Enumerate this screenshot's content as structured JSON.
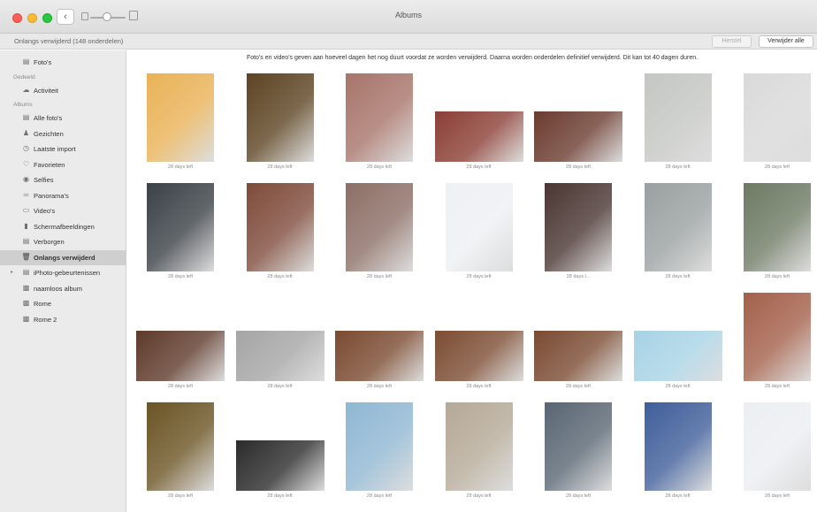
{
  "window": {
    "title": "Albums",
    "back_glyph": "‹"
  },
  "subbar": {
    "title": "Onlangs verwijderd (148 onderdelen)",
    "restore_label": "Herstel",
    "delete_all_label": "Verwijder alle"
  },
  "sidebar": {
    "top_items": [
      {
        "label": "Foto's",
        "icon": "photos-icon",
        "glyph": "▤"
      }
    ],
    "shared_header": "Gedeeld",
    "shared_items": [
      {
        "label": "Activiteit",
        "icon": "cloud-icon",
        "glyph": "☁"
      }
    ],
    "albums_header": "Albums",
    "album_items": [
      {
        "label": "Alle foto's",
        "icon": "all-photos-icon",
        "glyph": "▤"
      },
      {
        "label": "Gezichten",
        "icon": "person-icon",
        "glyph": "♟"
      },
      {
        "label": "Laatste import",
        "icon": "clock-icon",
        "glyph": "◷"
      },
      {
        "label": "Favorieten",
        "icon": "heart-icon",
        "glyph": "♡"
      },
      {
        "label": "Selfies",
        "icon": "selfie-icon",
        "glyph": "◉"
      },
      {
        "label": "Panorama's",
        "icon": "panorama-icon",
        "glyph": "═"
      },
      {
        "label": "Video's",
        "icon": "video-icon",
        "glyph": "▭"
      },
      {
        "label": "Schermafbeeldingen",
        "icon": "phone-icon",
        "glyph": "▮"
      },
      {
        "label": "Verborgen",
        "icon": "hidden-icon",
        "glyph": "▤"
      },
      {
        "label": "Onlangs verwijderd",
        "icon": "trash-icon",
        "glyph": "🗑",
        "selected": true
      },
      {
        "label": "iPhoto-gebeurtenissen",
        "icon": "folder-icon",
        "glyph": "▤",
        "disclosure": "▸"
      },
      {
        "label": "naamloos album",
        "icon": "album-thumbnail-icon",
        "glyph": "▩"
      },
      {
        "label": "Rome",
        "icon": "album-thumbnail-icon",
        "glyph": "▩"
      },
      {
        "label": "Rome 2",
        "icon": "album-thumbnail-icon",
        "glyph": "▩"
      }
    ]
  },
  "main": {
    "info_text": "Foto's en video's geven aan hoeveel dagen het nog duurt voordat ze worden verwijderd. Daarna worden onderdelen definitief verwijderd. Dit kan tot 40 dagen duren.",
    "rows": [
      {
        "items": [
          {
            "caption": "28 days left",
            "color": "#e9b257",
            "orientation": "portrait"
          },
          {
            "caption": "28 days left",
            "color": "#5c4322",
            "orientation": "portrait"
          },
          {
            "caption": "28 days left",
            "color": "#a7746a",
            "orientation": "portrait"
          },
          {
            "caption": "28 days left",
            "color": "#8b3f35",
            "orientation": "landscape"
          },
          {
            "caption": "28 days left",
            "color": "#6b3c30",
            "orientation": "landscape"
          },
          {
            "caption": "28 days left",
            "color": "#c4c6c3",
            "orientation": "portrait"
          },
          {
            "caption": "28 days left",
            "color": "#d9d9d9",
            "orientation": "portrait"
          }
        ]
      },
      {
        "items": [
          {
            "caption": "28 days left",
            "color": "#3b4147",
            "orientation": "portrait"
          },
          {
            "caption": "28 days left",
            "color": "#7e4b3a",
            "orientation": "portrait"
          },
          {
            "caption": "28 days left",
            "color": "#8c6f66",
            "orientation": "portrait"
          },
          {
            "caption": "28 days left",
            "color": "#eef0f3",
            "orientation": "portrait"
          },
          {
            "caption": "28 days l...",
            "color": "#4a3632",
            "orientation": "portrait"
          },
          {
            "caption": "28 days left",
            "color": "#9aa0a0",
            "orientation": "portrait"
          },
          {
            "caption": "28 days left",
            "color": "#6d7a63",
            "orientation": "portrait"
          }
        ]
      },
      {
        "items": [
          {
            "caption": "28 days left",
            "color": "#5e3a2b",
            "orientation": "landscape"
          },
          {
            "caption": "28 days left",
            "color": "#a5a5a5",
            "orientation": "landscape"
          },
          {
            "caption": "28 days left",
            "color": "#7a4a30",
            "orientation": "landscape"
          },
          {
            "caption": "28 days left",
            "color": "#7c4d33",
            "orientation": "landscape"
          },
          {
            "caption": "28 days left",
            "color": "#7a4b32",
            "orientation": "landscape"
          },
          {
            "caption": "28 days left",
            "color": "#a7d3e6",
            "orientation": "landscape"
          },
          {
            "caption": "28 days left",
            "color": "#a3604a",
            "orientation": "portrait"
          }
        ]
      },
      {
        "items": [
          {
            "caption": "28 days left",
            "color": "#6b5424",
            "orientation": "portrait"
          },
          {
            "caption": "28 days left",
            "color": "#2b2b2b",
            "orientation": "landscape"
          },
          {
            "caption": "28 days left",
            "color": "#8fb7d3",
            "orientation": "portrait"
          },
          {
            "caption": "28 days left",
            "color": "#b5a997",
            "orientation": "portrait"
          },
          {
            "caption": "28 days left",
            "color": "#596673",
            "orientation": "portrait"
          },
          {
            "caption": "28 days left",
            "color": "#3f5e9a",
            "orientation": "portrait"
          },
          {
            "caption": "28 days left",
            "color": "#eceef2",
            "orientation": "portrait"
          }
        ]
      }
    ]
  }
}
